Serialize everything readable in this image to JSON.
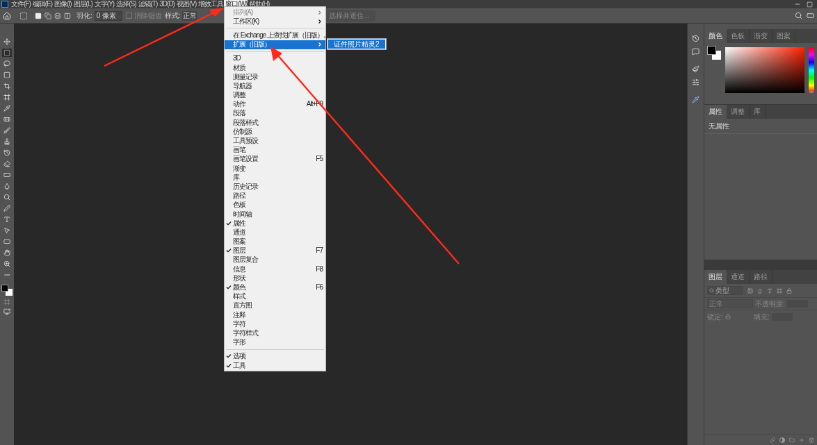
{
  "menubar": [
    {
      "label": "文件(F)",
      "selected": false
    },
    {
      "label": "编辑(E)",
      "selected": false
    },
    {
      "label": "图像(I)",
      "selected": false
    },
    {
      "label": "图层(L)",
      "selected": false
    },
    {
      "label": "文字(Y)",
      "selected": false
    },
    {
      "label": "选择(S)",
      "selected": false
    },
    {
      "label": "滤镜(T)",
      "selected": false
    },
    {
      "label": "3D(D)",
      "selected": false
    },
    {
      "label": "视图(V)",
      "selected": false
    },
    {
      "label": "增效工具",
      "selected": false
    },
    {
      "label": "窗口(W)",
      "selected": true
    },
    {
      "label": "帮助(H)",
      "selected": false
    }
  ],
  "options_bar": {
    "feather_label": "羽化:",
    "feather_value": "0 像素",
    "antialias": {
      "label": "消除锯齿",
      "checked": false,
      "disabled": true
    },
    "style_label": "样式:",
    "style_value": "正常",
    "select_mask": {
      "label": "选择并遮住...",
      "disabled": true
    }
  },
  "tools": [
    {
      "selected": false
    },
    {
      "selected": true
    },
    {
      "selected": false
    },
    {
      "selected": false
    },
    {
      "selected": false
    },
    {
      "selected": false
    },
    {
      "selected": false
    },
    {
      "selected": false
    },
    {
      "selected": false
    },
    {
      "selected": false
    },
    {
      "selected": false
    },
    {
      "selected": false
    },
    {
      "selected": false
    },
    {
      "selected": false
    },
    {
      "selected": false
    },
    {
      "selected": false
    },
    {
      "selected": false
    },
    {
      "selected": false
    },
    {
      "selected": false
    },
    {
      "selected": false
    },
    {
      "selected": false
    },
    {
      "selected": false
    }
  ],
  "window_menu": [
    {
      "kind": "item",
      "label": "排列(A)",
      "submenu": true,
      "disabled": true,
      "checked": false,
      "selected": false
    },
    {
      "kind": "item",
      "label": "工作区(K)",
      "submenu": true,
      "disabled": false,
      "checked": false,
      "selected": false
    },
    {
      "kind": "separator"
    },
    {
      "kind": "item",
      "label": "在 Exchange 上查找扩展（旧版）...",
      "disabled": false,
      "checked": false,
      "selected": false
    },
    {
      "kind": "item",
      "label": "扩展（旧版）",
      "submenu": true,
      "disabled": false,
      "checked": false,
      "selected": true
    },
    {
      "kind": "separator"
    },
    {
      "kind": "item",
      "label": "3D",
      "disabled": false,
      "checked": false,
      "selected": false
    },
    {
      "kind": "item",
      "label": "材质",
      "disabled": false,
      "checked": false,
      "selected": false
    },
    {
      "kind": "item",
      "label": "测量记录",
      "disabled": false,
      "checked": false,
      "selected": false
    },
    {
      "kind": "item",
      "label": "导航器",
      "disabled": false,
      "checked": false,
      "selected": false
    },
    {
      "kind": "item",
      "label": "调整",
      "disabled": false,
      "checked": false,
      "selected": false
    },
    {
      "kind": "item",
      "label": "动作",
      "shortcut": "Alt+F9",
      "disabled": false,
      "checked": false,
      "selected": false
    },
    {
      "kind": "item",
      "label": "段落",
      "disabled": false,
      "checked": false,
      "selected": false
    },
    {
      "kind": "item",
      "label": "段落样式",
      "disabled": false,
      "checked": false,
      "selected": false
    },
    {
      "kind": "item",
      "label": "仿制源",
      "disabled": false,
      "checked": false,
      "selected": false
    },
    {
      "kind": "item",
      "label": "工具预设",
      "disabled": false,
      "checked": false,
      "selected": false
    },
    {
      "kind": "item",
      "label": "画笔",
      "disabled": false,
      "checked": false,
      "selected": false
    },
    {
      "kind": "item",
      "label": "画笔设置",
      "shortcut": "F5",
      "disabled": false,
      "checked": false,
      "selected": false
    },
    {
      "kind": "item",
      "label": "渐变",
      "disabled": false,
      "checked": false,
      "selected": false
    },
    {
      "kind": "item",
      "label": "库",
      "disabled": false,
      "checked": false,
      "selected": false
    },
    {
      "kind": "item",
      "label": "历史记录",
      "disabled": false,
      "checked": false,
      "selected": false
    },
    {
      "kind": "item",
      "label": "路径",
      "disabled": false,
      "checked": false,
      "selected": false
    },
    {
      "kind": "item",
      "label": "色板",
      "disabled": false,
      "checked": false,
      "selected": false
    },
    {
      "kind": "item",
      "label": "时间轴",
      "disabled": false,
      "checked": false,
      "selected": false
    },
    {
      "kind": "item",
      "label": "属性",
      "disabled": false,
      "checked": true,
      "selected": false
    },
    {
      "kind": "item",
      "label": "通道",
      "disabled": false,
      "checked": false,
      "selected": false
    },
    {
      "kind": "item",
      "label": "图案",
      "disabled": false,
      "checked": false,
      "selected": false
    },
    {
      "kind": "item",
      "label": "图层",
      "shortcut": "F7",
      "disabled": false,
      "checked": true,
      "selected": false
    },
    {
      "kind": "item",
      "label": "图层复合",
      "disabled": false,
      "checked": false,
      "selected": false
    },
    {
      "kind": "item",
      "label": "信息",
      "shortcut": "F8",
      "disabled": false,
      "checked": false,
      "selected": false
    },
    {
      "kind": "item",
      "label": "形状",
      "disabled": false,
      "checked": false,
      "selected": false
    },
    {
      "kind": "item",
      "label": "颜色",
      "shortcut": "F6",
      "disabled": false,
      "checked": true,
      "selected": false
    },
    {
      "kind": "item",
      "label": "样式",
      "disabled": false,
      "checked": false,
      "selected": false
    },
    {
      "kind": "item",
      "label": "直方图",
      "disabled": false,
      "checked": false,
      "selected": false
    },
    {
      "kind": "item",
      "label": "注释",
      "disabled": false,
      "checked": false,
      "selected": false
    },
    {
      "kind": "item",
      "label": "字符",
      "disabled": false,
      "checked": false,
      "selected": false
    },
    {
      "kind": "item",
      "label": "字符样式",
      "disabled": false,
      "checked": false,
      "selected": false
    },
    {
      "kind": "item",
      "label": "字形",
      "disabled": false,
      "checked": false,
      "selected": false
    },
    {
      "kind": "separator"
    },
    {
      "kind": "item",
      "label": "选项",
      "disabled": false,
      "checked": true,
      "selected": false
    },
    {
      "kind": "item",
      "label": "工具",
      "disabled": false,
      "checked": true,
      "selected": false
    }
  ],
  "submenu": [
    {
      "label": "证件照片精灵2",
      "selected": true
    }
  ],
  "color_panel": {
    "hue_slider": {
      "level": 0
    },
    "tabs": [
      {
        "label": "颜色",
        "selected": true
      },
      {
        "label": "色板",
        "selected": false
      },
      {
        "label": "渐变",
        "selected": false
      },
      {
        "label": "图案",
        "selected": false
      }
    ]
  },
  "properties_panel": {
    "tabs": [
      {
        "label": "属性",
        "selected": true
      },
      {
        "label": "调整",
        "selected": false
      },
      {
        "label": "库",
        "selected": false
      }
    ],
    "message": "无属性"
  },
  "layers_panel": {
    "tabs": [
      {
        "label": "图层",
        "selected": true
      },
      {
        "label": "通道",
        "selected": false
      },
      {
        "label": "路径",
        "selected": false
      }
    ],
    "filter_placeholder": "类型",
    "blend_mode": "正常",
    "opacity_label": "不透明度:",
    "lock_label": "锁定:",
    "fill_label": "填充:"
  }
}
